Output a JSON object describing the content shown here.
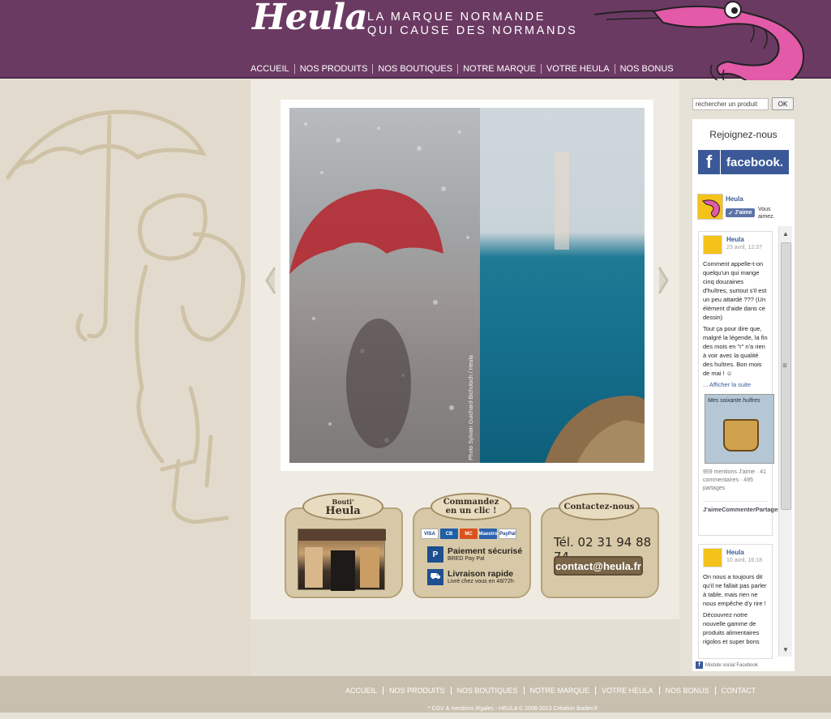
{
  "header": {
    "logo_text": "Heula",
    "tagline_line1": "LA MARQUE NORMANDE",
    "tagline_line2": "QUI CAUSE DES NORMANDS",
    "nav": [
      "ACCUEIL",
      "NOS PRODUITS",
      "NOS BOUTIQUES",
      "NOTRE MARQUE",
      "VOTRE HEULA",
      "NOS BONUS"
    ]
  },
  "slider": {
    "photo_credit": "Photo Sylvain Guichard-Bichotsch / Heula"
  },
  "promos": {
    "shop": {
      "title_line1": "Bouti'",
      "title_line2": "Heula"
    },
    "order": {
      "title_line1": "Commandez",
      "title_line2": "en un clic !",
      "cards": [
        "VISA",
        "CB",
        "MC",
        "Maestro",
        "PayPal"
      ],
      "payment_title": "Paiement sécurisé",
      "payment_sub": "BRED Pay Pal",
      "delivery_title": "Livraison rapide",
      "delivery_sub": "Livré chez vous en 48/72h"
    },
    "contact": {
      "title": "Contactez-nous",
      "phone": "Tél. 02 31 94 88 74",
      "email": "contact@heula.fr"
    }
  },
  "sidebar": {
    "search_placeholder": "rechercher un produit",
    "search_button": "OK",
    "join_title": "Rejoignez-nous",
    "facebook_word": "facebook.",
    "page_name": "Heula",
    "like_label": "J'aime",
    "you_like": "Vous aimez.",
    "posts": [
      {
        "author": "Heula",
        "date": "23 avril, 12:37",
        "text1": "Comment appelle-t-on quelqu'un qui mange cinq douzaines d'huîtres, surtout s'il est un peu attardé ??? (Un élément d'aide dans ce dessin)",
        "text2": "Tout ça pour dire que, malgré la légende, la fin des mois en \"r\" n'a rien à voir avec la qualité des huîtres. Bon mois de mai ! ☺",
        "more": "... Afficher la suite",
        "image_title": "Mes soixante huîtres",
        "stats": "959 mentions J'aime · 41 commentaires · 495 partages",
        "actions": [
          "J'aime",
          "Commenter",
          "Partager"
        ]
      },
      {
        "author": "Heula",
        "date": "10 avril, 16:18",
        "text1": "On nous a toujours dit qu'il ne fallait pas parler à table, mais rien ne nous empêche d'y rire !",
        "text2": "Découvrez notre nouvelle gamme de produits alimentaires rigolos et super bons"
      }
    ],
    "fb_footer": "Module social Facebook"
  },
  "footer": {
    "nav": [
      "ACCUEIL",
      "NOS PRODUITS",
      "NOS BOUTIQUES",
      "NOTRE MARQUE",
      "VOTRE HEULA",
      "NOS BONUS",
      "CONTACT"
    ],
    "cgv": "* CGV & mentions légales",
    "copyright": " - HEULA © 2008-2013",
    "creation": "Création ibadev.fr"
  },
  "colors": {
    "header_purple": "#6b3a63",
    "facebook_blue": "#3b5998",
    "background_beige": "#e7e2d7"
  }
}
